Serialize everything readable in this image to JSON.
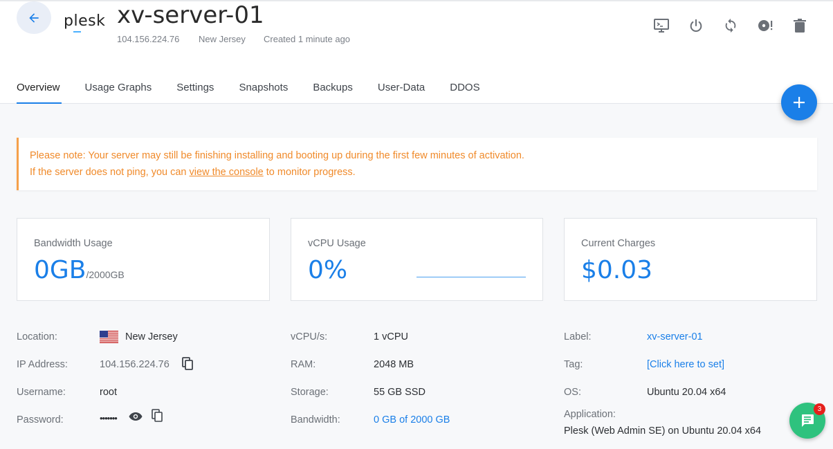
{
  "header": {
    "logo_text": "plesk",
    "server_name": "xv-server-01",
    "ip": "104.156.224.76",
    "location": "New Jersey",
    "created": "Created 1 minute ago"
  },
  "actions": [
    "console-icon",
    "power-icon",
    "restart-icon",
    "reinstall-icon",
    "delete-icon"
  ],
  "tabs": [
    {
      "label": "Overview",
      "active": true
    },
    {
      "label": "Usage Graphs"
    },
    {
      "label": "Settings"
    },
    {
      "label": "Snapshots"
    },
    {
      "label": "Backups"
    },
    {
      "label": "User-Data"
    },
    {
      "label": "DDOS"
    }
  ],
  "notice": {
    "line1": "Please note: Your server may still be finishing installing and booting up during the first few minutes of activation.",
    "line2_prefix": "If the server does not ping, you can ",
    "line2_link": "view the console",
    "line2_suffix": " to monitor progress."
  },
  "cards": {
    "bandwidth": {
      "title": "Bandwidth Usage",
      "value": "0GB",
      "sub": "/2000GB"
    },
    "vcpu": {
      "title": "vCPU Usage",
      "value": "0%"
    },
    "charges": {
      "title": "Current Charges",
      "value": "$0.03"
    }
  },
  "details": {
    "location_label": "Location:",
    "location_value": "New Jersey",
    "ip_label": "IP Address:",
    "ip_value": "104.156.224.76",
    "username_label": "Username:",
    "username_value": "root",
    "password_label": "Password:",
    "password_value": "•••••••",
    "vcpu_label": "vCPU/s:",
    "vcpu_value": "1 vCPU",
    "ram_label": "RAM:",
    "ram_value": "2048 MB",
    "storage_label": "Storage:",
    "storage_value": "55 GB SSD",
    "bandwidth_label": "Bandwidth:",
    "bandwidth_value": "0 GB of 2000 GB",
    "label_label": "Label:",
    "label_value": "xv-server-01",
    "tag_label": "Tag:",
    "tag_value": "[Click here to set]",
    "os_label": "OS:",
    "os_value": "Ubuntu 20.04 x64",
    "application_label": "Application:",
    "application_value": "Plesk (Web Admin SE) on Ubuntu 20.04 x64"
  },
  "chat": {
    "badge": "3"
  },
  "colors": {
    "accent": "#1a7fe8",
    "warning": "#f08a2a",
    "chat": "#2ec27e",
    "badge": "#e5201b"
  }
}
